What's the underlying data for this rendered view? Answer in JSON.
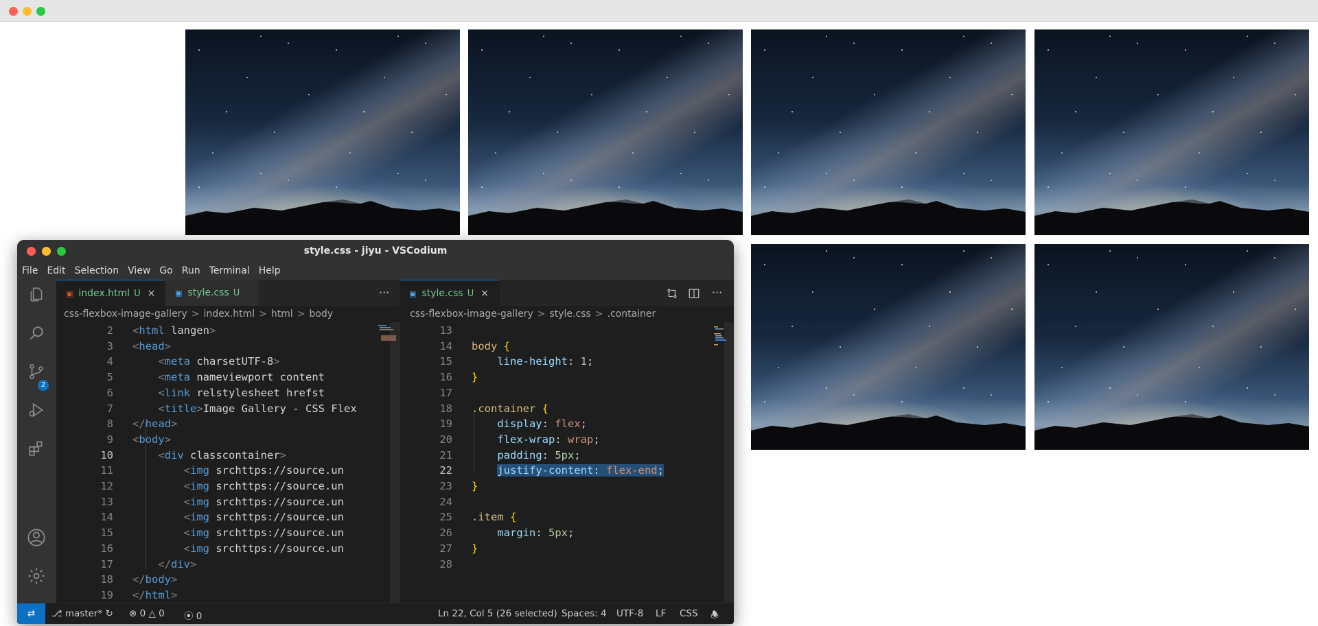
{
  "browser": {
    "traffic_lights": [
      "#ff5f57",
      "#febc2e",
      "#28c840"
    ]
  },
  "gallery": {
    "image_count": 6,
    "arrangement": "flex-end"
  },
  "vscodium": {
    "title": "style.css - jiyu - VSCodium",
    "menu": [
      "File",
      "Edit",
      "Selection",
      "View",
      "Go",
      "Run",
      "Terminal",
      "Help"
    ],
    "activity_icons": [
      "explorer-icon",
      "search-icon",
      "source-control-icon",
      "run-debug-icon",
      "extensions-icon",
      "account-icon",
      "settings-gear-icon"
    ],
    "scm_badge": "2",
    "left_tabs": [
      {
        "name": "index.html",
        "status": "U",
        "icon": "html-file-icon"
      },
      {
        "name": "style.css",
        "status": "U",
        "icon": "css-file-icon"
      }
    ],
    "left_more": "···",
    "right_tabs": [
      {
        "name": "style.css",
        "status": "U",
        "icon": "css-file-icon"
      }
    ],
    "right_close": "×",
    "left_breadcrumb": [
      "css-flexbox-image-gallery",
      "index.html",
      "html",
      "body"
    ],
    "right_breadcrumb": [
      "css-flexbox-image-gallery",
      "style.css",
      ".container"
    ],
    "left_code": [
      {
        "n": "2",
        "text": "<html lang=\"en\">"
      },
      {
        "n": "3",
        "text": "<head>"
      },
      {
        "n": "4",
        "text": "    <meta charset=\"UTF-8\">"
      },
      {
        "n": "5",
        "text": "    <meta name=\"viewport\" content=\""
      },
      {
        "n": "6",
        "text": "    <link rel=\"stylesheet\" href=\"st"
      },
      {
        "n": "7",
        "text": "    <title>Image Gallery - CSS Flex"
      },
      {
        "n": "8",
        "text": "</head>"
      },
      {
        "n": "9",
        "text": "<body>"
      },
      {
        "n": "10",
        "text": "    <div class=\"container\">"
      },
      {
        "n": "11",
        "text": "        <img src=\"https://source.un"
      },
      {
        "n": "12",
        "text": "        <img src=\"https://source.un"
      },
      {
        "n": "13",
        "text": "        <img src=\"https://source.un"
      },
      {
        "n": "14",
        "text": "        <img src=\"https://source.un"
      },
      {
        "n": "15",
        "text": "        <img src=\"https://source.un"
      },
      {
        "n": "16",
        "text": "        <img src=\"https://source.un"
      },
      {
        "n": "17",
        "text": "    </div>"
      },
      {
        "n": "18",
        "text": "</body>"
      },
      {
        "n": "19",
        "text": "</html>"
      }
    ],
    "right_code": [
      {
        "n": "13",
        "text": ""
      },
      {
        "n": "14",
        "text": "body {"
      },
      {
        "n": "15",
        "text": "    line-height: 1;"
      },
      {
        "n": "16",
        "text": "}"
      },
      {
        "n": "17",
        "text": ""
      },
      {
        "n": "18",
        "text": ".container {"
      },
      {
        "n": "19",
        "text": "    display: flex;"
      },
      {
        "n": "20",
        "text": "    flex-wrap: wrap;"
      },
      {
        "n": "21",
        "text": "    padding: 5px;"
      },
      {
        "n": "22",
        "text": "    justify-content: flex-end;"
      },
      {
        "n": "23",
        "text": "}"
      },
      {
        "n": "24",
        "text": ""
      },
      {
        "n": "25",
        "text": ".item {"
      },
      {
        "n": "26",
        "text": "    margin: 5px;"
      },
      {
        "n": "27",
        "text": "}"
      },
      {
        "n": "28",
        "text": ""
      }
    ],
    "status": {
      "branch": "master*",
      "problems_errors": "0",
      "problems_warnings": "0",
      "ports": "0",
      "cursor": "Ln 22, Col 5 (26 selected)",
      "spaces": "Spaces: 4",
      "encoding": "UTF-8",
      "eol": "LF",
      "language": "CSS"
    }
  }
}
